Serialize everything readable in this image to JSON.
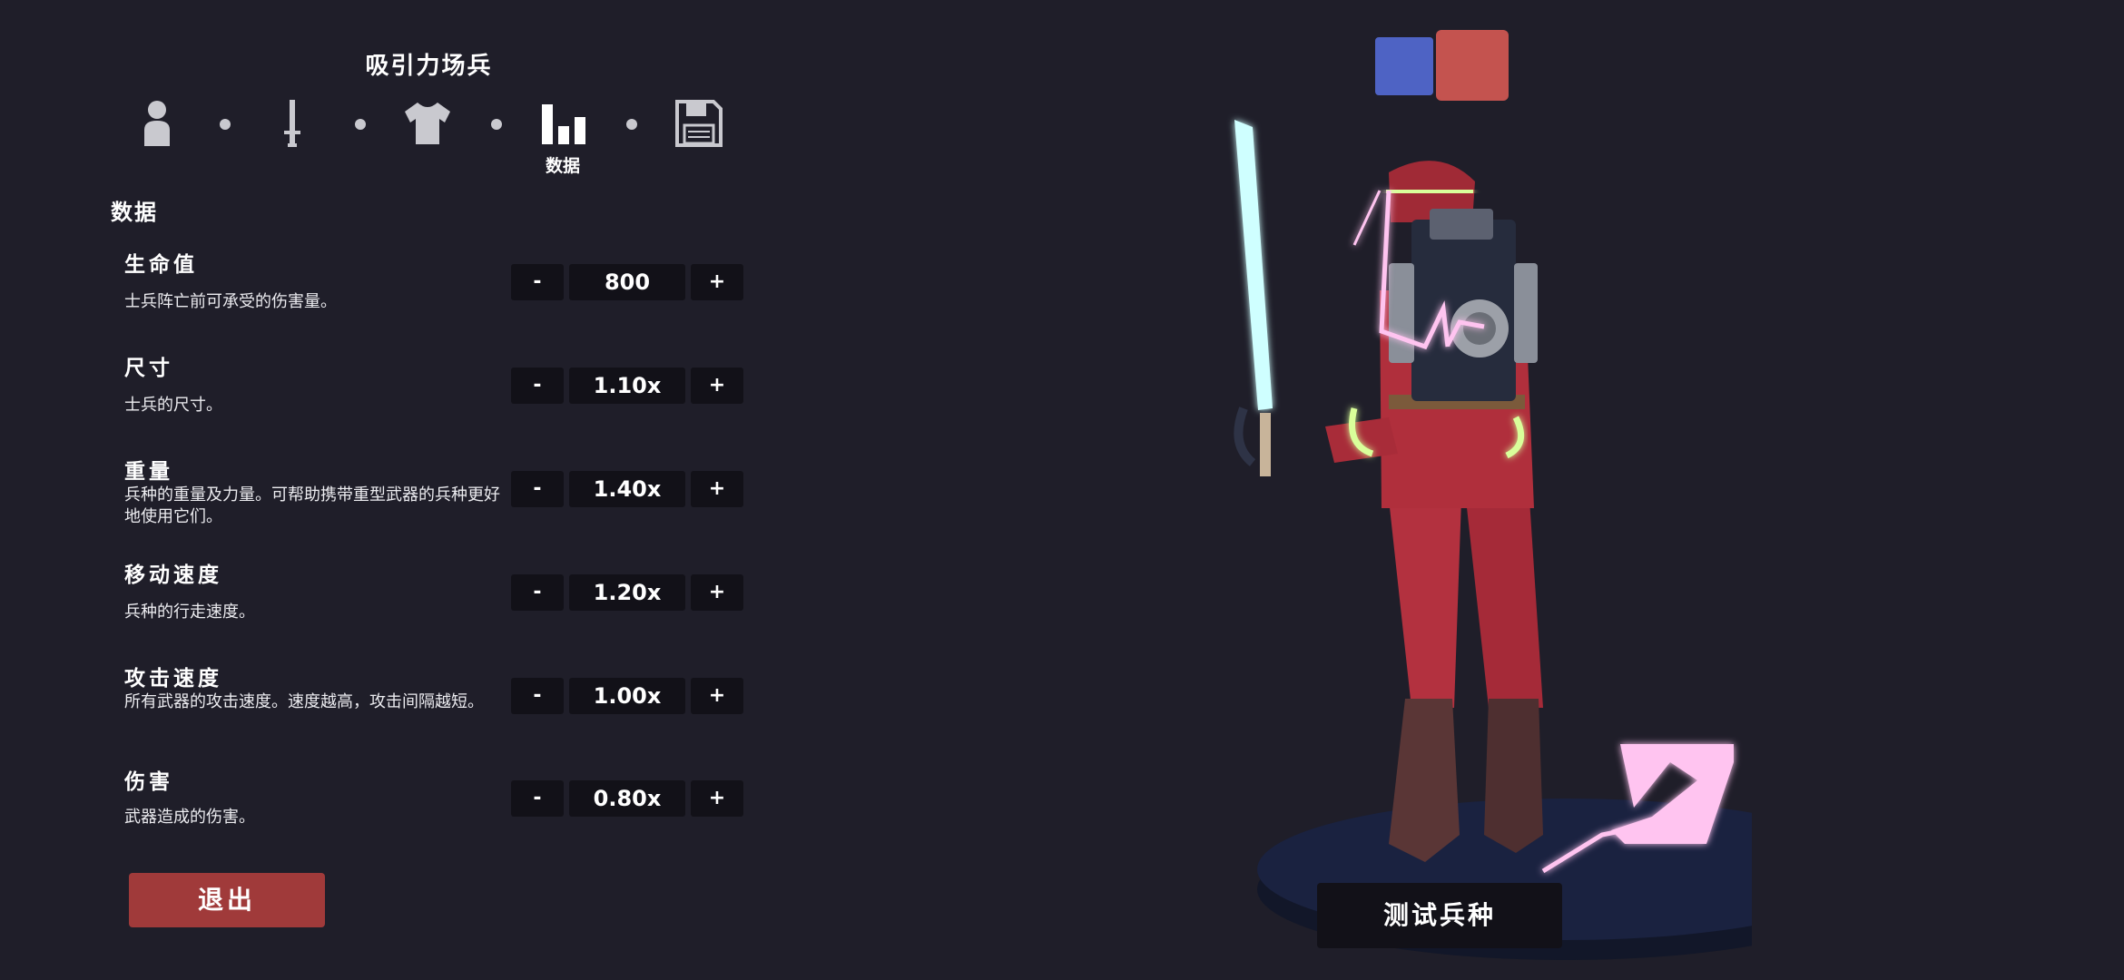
{
  "unit_title": "吸引力场兵",
  "steps": {
    "icons": [
      "person-icon",
      "sword-icon",
      "shirt-icon",
      "bar-chart-icon",
      "save-disk-icon"
    ],
    "active_label": "数据"
  },
  "section_heading": "数据",
  "stats": [
    {
      "name": "生命值",
      "desc": "士兵阵亡前可承受的伤害量。",
      "value": "800"
    },
    {
      "name": "尺寸",
      "desc": "士兵的尺寸。",
      "value": "1.10x"
    },
    {
      "name": "重量",
      "desc": "兵种的重量及力量。可帮助携带重型武器的兵种更好地使用它们。",
      "value": "1.40x"
    },
    {
      "name": "移动速度",
      "desc": "兵种的行走速度。",
      "value": "1.20x"
    },
    {
      "name": "攻击速度",
      "desc": "所有武器的攻击速度。速度越高，攻击间隔越短。",
      "value": "1.00x"
    },
    {
      "name": "伤害",
      "desc": "武器造成的伤害。",
      "value": "0.80x"
    }
  ],
  "controls": {
    "minus_label": "-",
    "plus_label": "+"
  },
  "exit_label": "退出",
  "test_label": "测试兵种",
  "colors": {
    "background": "#1f1e29",
    "button_dark": "#121118",
    "exit_red": "#a03a3a",
    "team_blue": "#4e63c4",
    "team_red": "#c4534f"
  }
}
